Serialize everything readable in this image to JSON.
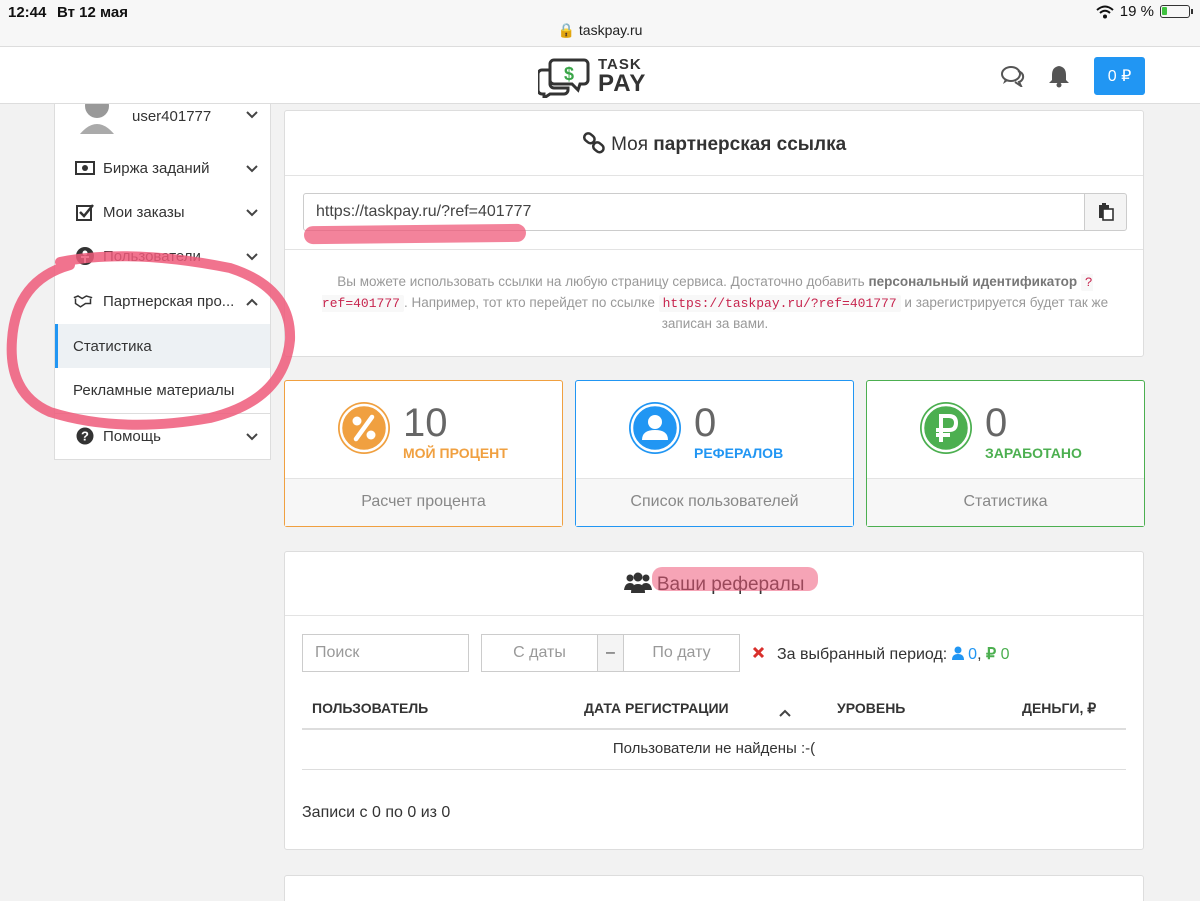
{
  "status_bar": {
    "time": "12:44",
    "date": "Вт 12 мая",
    "battery": "19 %",
    "battery_level": 0.19,
    "url": "taskpay.ru"
  },
  "header": {
    "logo_line1": "TASK",
    "logo_line2": "PAY",
    "balance": "0 ₽"
  },
  "sidebar": {
    "user": "user401777",
    "items": [
      {
        "label": "Биржа заданий"
      },
      {
        "label": "Мои заказы"
      },
      {
        "label": "Пользователи"
      },
      {
        "label": "Партнерская про..."
      }
    ],
    "subitems": [
      {
        "label": "Статистика"
      },
      {
        "label": "Рекламные материалы"
      }
    ],
    "help": "Помощь"
  },
  "referral": {
    "title_plain": "Моя",
    "title_bold": "партнерская ссылка",
    "link": "https://taskpay.ru/?ref=401777",
    "info_1": "Вы можете использовать ссылки на любую страницу сервиса. Достаточно добавить",
    "info_bold": "персональный идентификатор",
    "code_1": "?ref=401777",
    "info_2": ". Например, тот кто перейдет по ссылке",
    "code_2": "https://taskpay.ru/?ref=401777",
    "info_3": "и зарегистрируется будет так же записан за вами."
  },
  "stats": [
    {
      "value": "10",
      "label": "МОЙ ПРОЦЕНТ",
      "footer": "Расчет процента",
      "color": "#f0a040",
      "icon": "percent-icon"
    },
    {
      "value": "0",
      "label": "РЕФЕРАЛОВ",
      "footer": "Список пользователей",
      "color": "#2196f3",
      "icon": "user-icon"
    },
    {
      "value": "0",
      "label": "ЗАРАБОТАНО",
      "footer": "Статистика",
      "color": "#4caf50",
      "icon": "ruble-icon"
    }
  ],
  "referrals": {
    "title": "Ваши рефералы",
    "search_placeholder": "Поиск",
    "date_from": "С даты",
    "date_sep": "–",
    "date_to": "По дату",
    "period_label": "За выбранный период:",
    "period_users": "0",
    "period_money": "0",
    "columns": [
      "ПОЛЬЗОВАТЕЛЬ",
      "ДАТА РЕГИСТРАЦИИ",
      "УРОВЕНЬ",
      "ДЕНЬГИ, ₽"
    ],
    "empty": "Пользователи не найдены :-(",
    "records": "Записи с 0 по 0 из 0"
  }
}
